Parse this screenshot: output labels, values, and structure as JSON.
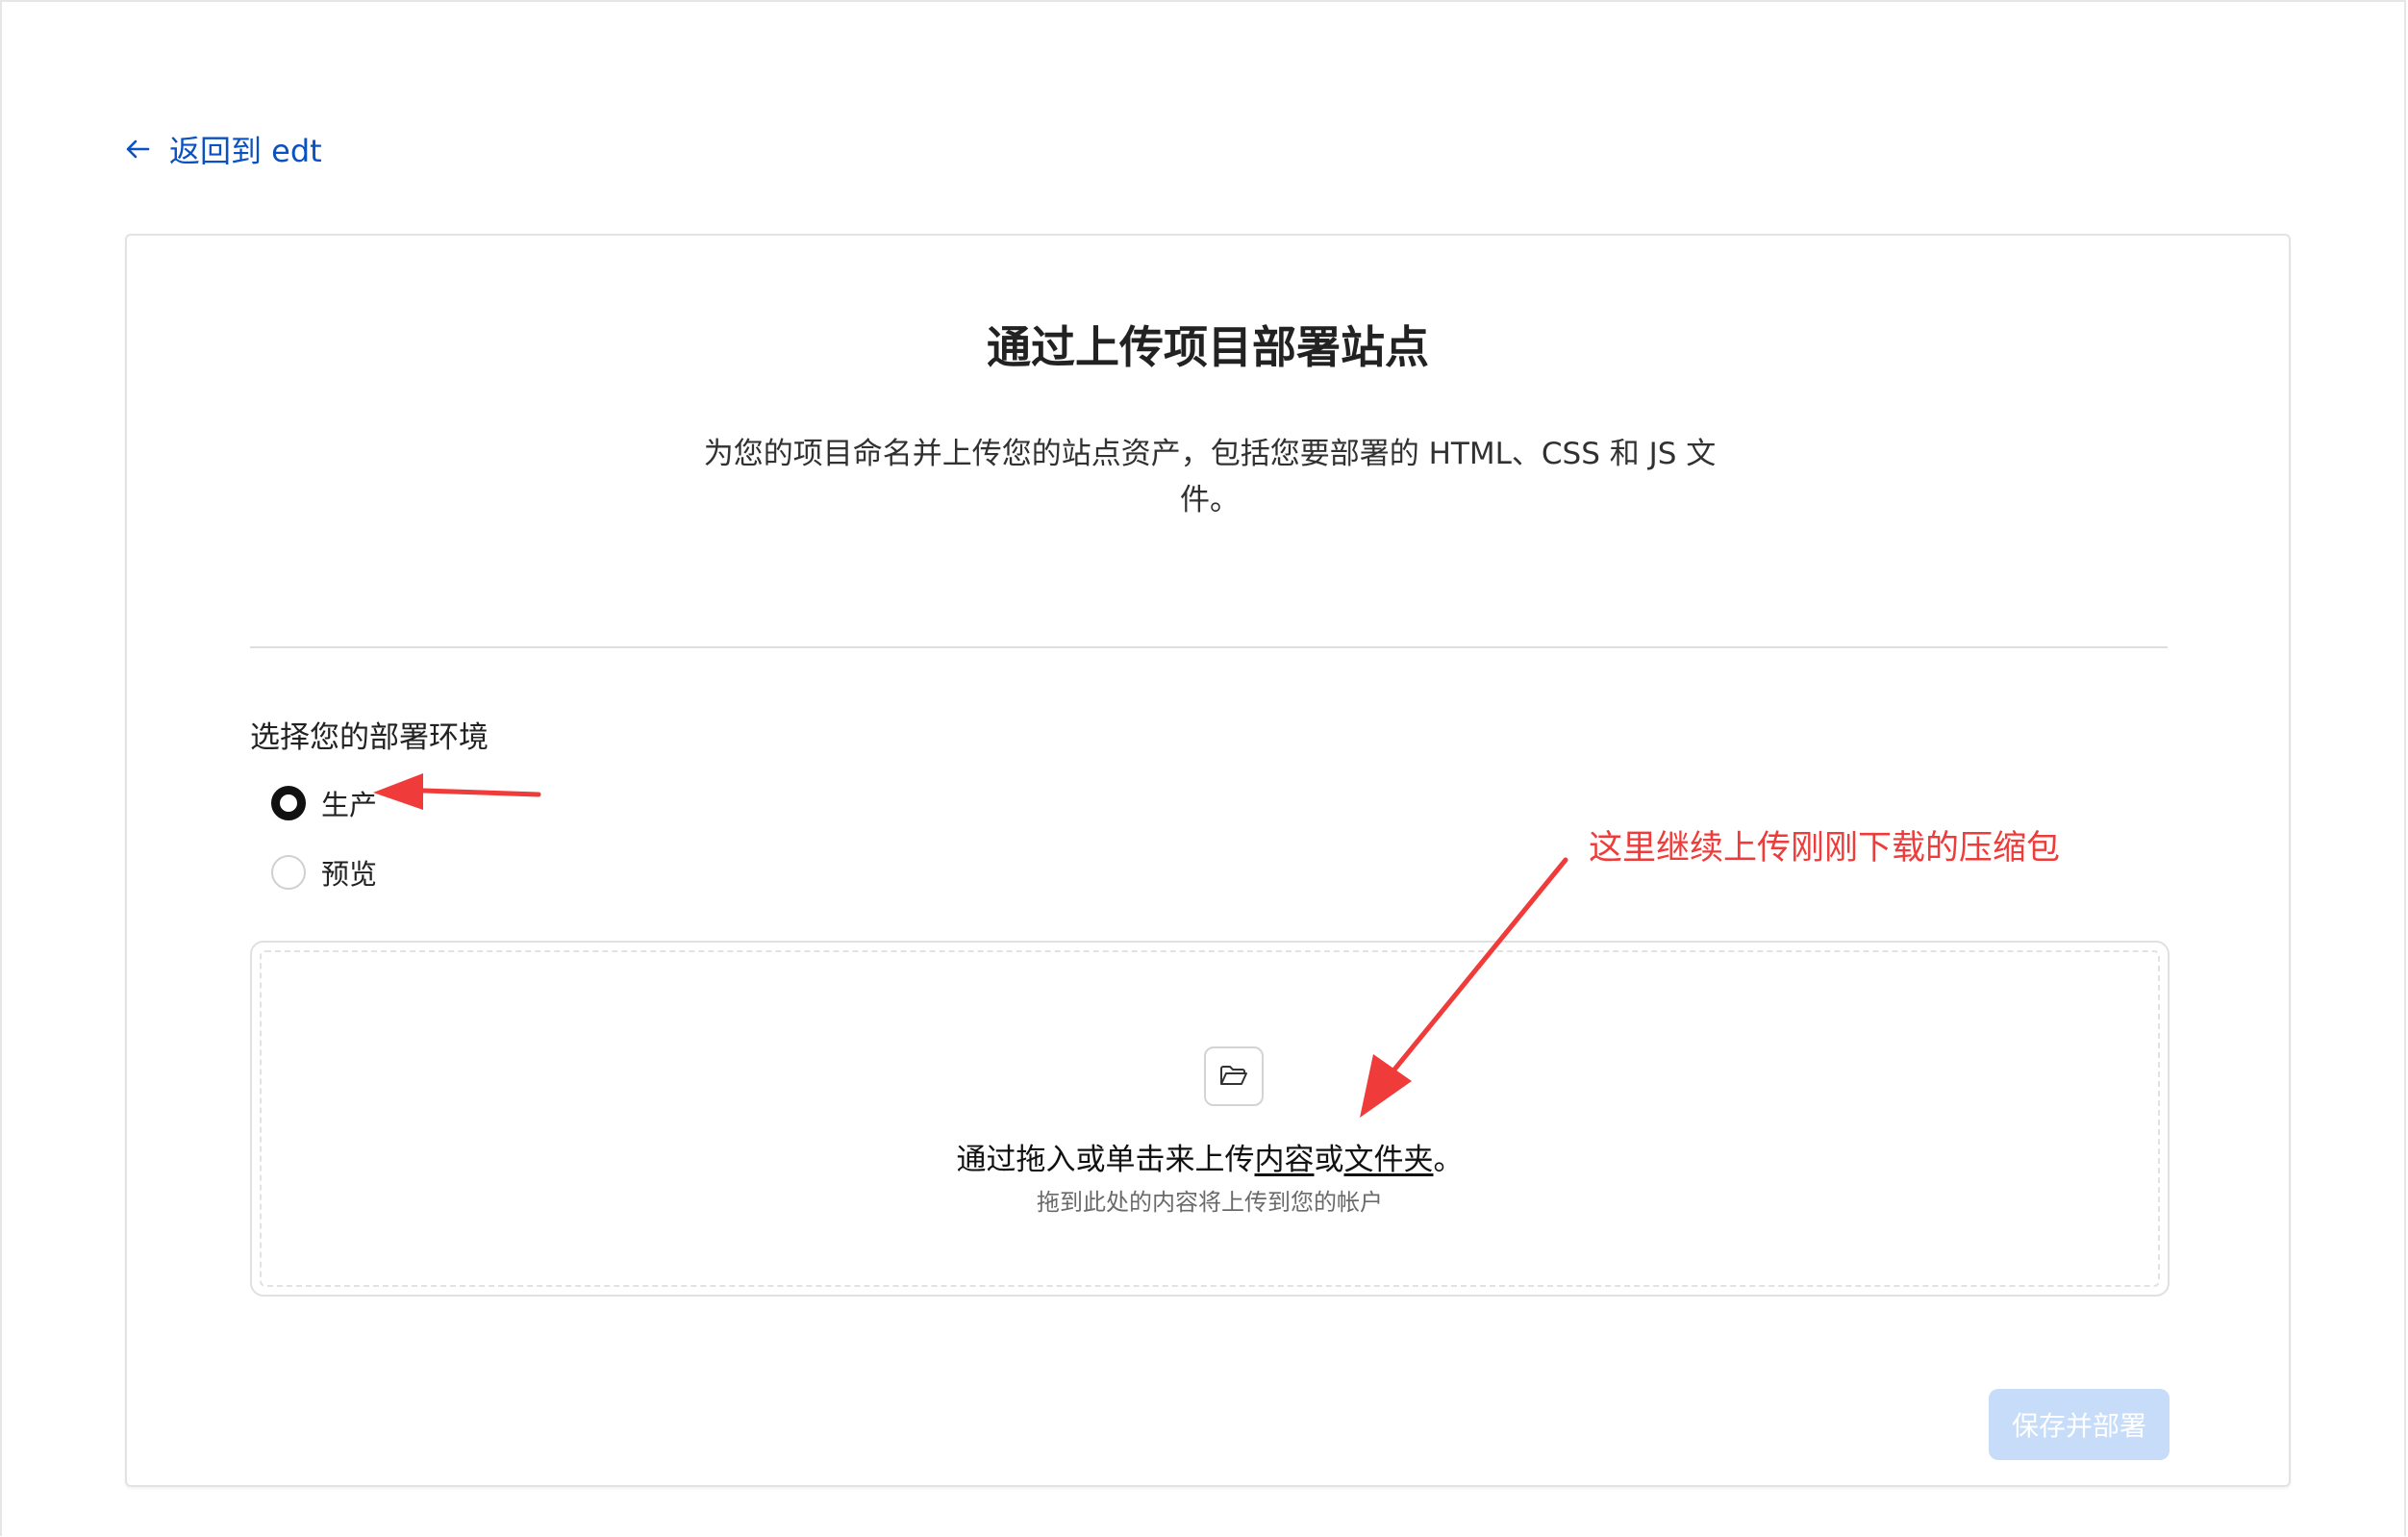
{
  "nav": {
    "back_label": "返回到 edt"
  },
  "card": {
    "title": "通过上传项目部署站点",
    "description": "为您的项目命名并上传您的站点资产，包括您要部署的 HTML、CSS 和 JS 文件。"
  },
  "environment": {
    "label": "选择您的部署环境",
    "options": [
      {
        "label": "生产",
        "selected": true
      },
      {
        "label": "预览",
        "selected": false
      }
    ]
  },
  "upload": {
    "icon": "folder-open-icon",
    "text_prefix": "通过拖入或单击来上传",
    "link_content": "内容",
    "text_or": "或",
    "link_folder": "文件夹",
    "text_suffix": "。",
    "subtext": "拖到此处的内容将上传到您的帐户"
  },
  "actions": {
    "save_deploy_label": "保存并部署",
    "save_deploy_enabled": false
  },
  "annotation": {
    "text": "这里继续上传刚刚下载的压缩包",
    "color": "#ef3b39"
  },
  "colors": {
    "link": "#0a51c2",
    "button_disabled": "#c6dcf9",
    "annotation": "#ef3b39"
  }
}
